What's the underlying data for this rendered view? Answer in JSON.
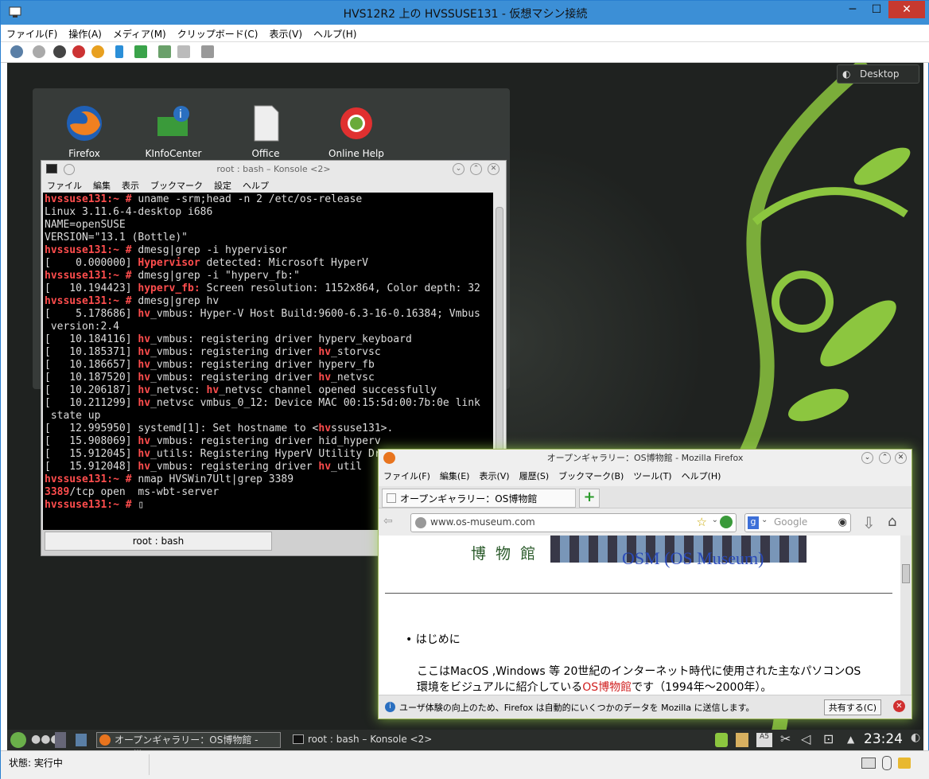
{
  "window": {
    "title": "HVS12R2 上の HVSSUSE131  - 仮想マシン接続",
    "menu": [
      "ファイル(F)",
      "操作(A)",
      "メディア(M)",
      "クリップボード(C)",
      "表示(V)",
      "ヘルプ(H)"
    ],
    "status": "状態: 実行中"
  },
  "desktop": {
    "desktop_button": "Desktop",
    "icons": [
      {
        "label": "Firefox",
        "icon": "firefox-icon"
      },
      {
        "label": "KInfoCenter",
        "icon": "kinfocenter-icon"
      },
      {
        "label": "Office",
        "icon": "office-icon"
      },
      {
        "label": "Online Help",
        "icon": "lifebuoy-icon"
      }
    ]
  },
  "konsole": {
    "title": "root : bash – Konsole <2>",
    "menu": [
      "ファイル",
      "編集",
      "表示",
      "ブックマーク",
      "設定",
      "ヘルプ"
    ],
    "tab": "root : bash",
    "lines": [
      [
        {
          "t": "hvssuse131:~ # ",
          "r": true
        },
        {
          "t": "uname -srm;head -n 2 /etc/os-release"
        }
      ],
      [
        {
          "t": "Linux 3.11.6-4-desktop i686"
        }
      ],
      [
        {
          "t": "NAME=openSUSE"
        }
      ],
      [
        {
          "t": "VERSION=\"13.1 (Bottle)\""
        }
      ],
      [
        {
          "t": "hvssuse131:~ # ",
          "r": true
        },
        {
          "t": "dmesg|grep -i hypervisor"
        }
      ],
      [
        {
          "t": "[    0.000000] "
        },
        {
          "t": "Hypervisor",
          "r": true
        },
        {
          "t": " detected: Microsoft HyperV"
        }
      ],
      [
        {
          "t": "hvssuse131:~ # ",
          "r": true
        },
        {
          "t": "dmesg|grep -i \"hyperv_fb:\""
        }
      ],
      [
        {
          "t": "[   10.194423] "
        },
        {
          "t": "hyperv_fb:",
          "r": true
        },
        {
          "t": " Screen resolution: 1152x864, Color depth: 32"
        }
      ],
      [
        {
          "t": "hvssuse131:~ # ",
          "r": true
        },
        {
          "t": "dmesg|grep hv"
        }
      ],
      [
        {
          "t": "[    5.178686] "
        },
        {
          "t": "hv",
          "r": true
        },
        {
          "t": "_vmbus: Hyper-V Host Build:9600-6.3-16-0.16384; Vmbus"
        }
      ],
      [
        {
          "t": " version:2.4"
        }
      ],
      [
        {
          "t": "[   10.184116] "
        },
        {
          "t": "hv",
          "r": true
        },
        {
          "t": "_vmbus: registering driver hyperv_keyboard"
        }
      ],
      [
        {
          "t": "[   10.185371] "
        },
        {
          "t": "hv",
          "r": true
        },
        {
          "t": "_vmbus: registering driver "
        },
        {
          "t": "hv",
          "r": true
        },
        {
          "t": "_storvsc"
        }
      ],
      [
        {
          "t": "[   10.186657] "
        },
        {
          "t": "hv",
          "r": true
        },
        {
          "t": "_vmbus: registering driver hyperv_fb"
        }
      ],
      [
        {
          "t": "[   10.187520] "
        },
        {
          "t": "hv",
          "r": true
        },
        {
          "t": "_vmbus: registering driver "
        },
        {
          "t": "hv",
          "r": true
        },
        {
          "t": "_netvsc"
        }
      ],
      [
        {
          "t": "[   10.206187] "
        },
        {
          "t": "hv",
          "r": true
        },
        {
          "t": "_netvsc: "
        },
        {
          "t": "hv",
          "r": true
        },
        {
          "t": "_netvsc channel opened successfully"
        }
      ],
      [
        {
          "t": "[   10.211299] "
        },
        {
          "t": "hv",
          "r": true
        },
        {
          "t": "_netvsc vmbus_0_12: Device MAC 00:15:5d:00:7b:0e link"
        }
      ],
      [
        {
          "t": " state up"
        }
      ],
      [
        {
          "t": "[   12.995950] systemd[1]: Set hostname to <"
        },
        {
          "t": "hv",
          "r": true
        },
        {
          "t": "ssuse131>."
        }
      ],
      [
        {
          "t": "[   15.908069] "
        },
        {
          "t": "hv",
          "r": true
        },
        {
          "t": "_vmbus: registering driver hid_hyperv"
        }
      ],
      [
        {
          "t": "[   15.912045] "
        },
        {
          "t": "hv",
          "r": true
        },
        {
          "t": "_utils: Registering HyperV Utility Driver"
        }
      ],
      [
        {
          "t": "[   15.912048] "
        },
        {
          "t": "hv",
          "r": true
        },
        {
          "t": "_vmbus: registering driver "
        },
        {
          "t": "hv",
          "r": true
        },
        {
          "t": "_util"
        }
      ],
      [
        {
          "t": "hvssuse131:~ # ",
          "r": true
        },
        {
          "t": "nmap HVSWin7Ult|grep 3389"
        }
      ],
      [
        {
          "t": "3389",
          "r": true
        },
        {
          "t": "/tcp open  ms-wbt-server"
        }
      ],
      [
        {
          "t": "hvssuse131:~ # ",
          "r": true
        },
        {
          "t": "▯"
        }
      ]
    ]
  },
  "firefox": {
    "title": "オープンギャラリー：OS博物館 - Mozilla Firefox",
    "menu": [
      "ファイル(F)",
      "編集(E)",
      "表示(V)",
      "履歴(S)",
      "ブックマーク(B)",
      "ツール(T)",
      "ヘルプ(H)"
    ],
    "tab": "オープンギャラリー：OS博物館",
    "url": "www.os-museum.com",
    "search_placeholder": "Google",
    "logo_text": "博 物 館",
    "heading": "OSM (OS Museum)",
    "bullet": "はじめに",
    "para1": "ここはMacOS ,Windows 等 20世紀のインターネット時代に使用された主なパソコンOS",
    "para2_pre": "環境をビジュアルに紹介している",
    "para2_link": "OS博物館",
    "para2_post": "です（1994年～2000年）。",
    "notice": "ユーザ体験の向上のため、Firefox は自動的にいくつかのデータを Mozilla に送信します。",
    "share_button": "共有する(C)"
  },
  "taskbar": {
    "task1": "オープンギャラリー：OS博物館 - Mozilla",
    "task2": "root : bash – Konsole <2>",
    "clock": "23:24"
  },
  "colors": {
    "accent_green": "#8cc63f",
    "term_red": "#ff4d4d",
    "hyperv_blue": "#3c8fd6"
  }
}
